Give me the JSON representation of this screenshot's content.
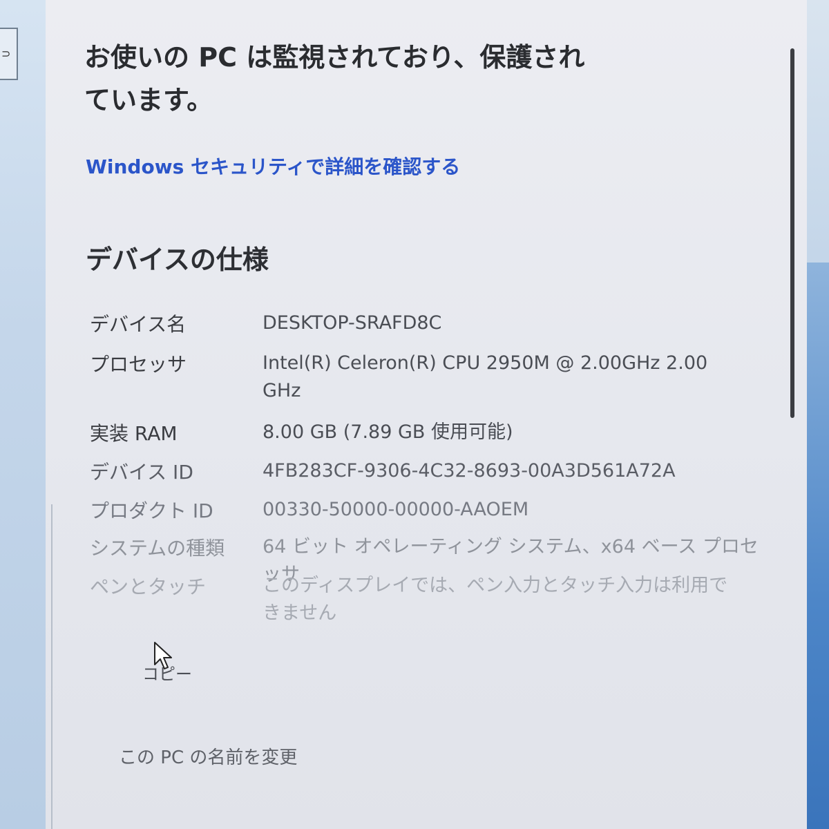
{
  "left_strip": {
    "nav_glyph": "⊃"
  },
  "security": {
    "headline_line1": "お使いの PC は監視されており、保護され",
    "headline_line2": "ています。",
    "link": "Windows セキュリティで詳細を確認する"
  },
  "device_specs": {
    "title": "デバイスの仕様",
    "rows": [
      {
        "label": "デバイス名",
        "value": "DESKTOP-SRAFD8C"
      },
      {
        "label": "プロセッサ",
        "value": "Intel(R) Celeron(R) CPU 2950M @ 2.00GHz   2.00 GHz"
      },
      {
        "label": "実装 RAM",
        "value": "8.00 GB (7.89 GB 使用可能)"
      },
      {
        "label": "デバイス ID",
        "value": "4FB283CF-9306-4C32-8693-00A3D561A72A"
      },
      {
        "label": "プロダクト ID",
        "value": "00330-50000-00000-AAOEM"
      },
      {
        "label": "システムの種類",
        "value": "64 ビット オペレーティング システム、x64 ベース プロセッサ"
      },
      {
        "label": "ペンとタッチ",
        "value": "このディスプレイでは、ペン入力とタッチ入力は利用できません"
      }
    ],
    "copy_label": "コピー",
    "rename_label": "この PC の名前を変更"
  }
}
